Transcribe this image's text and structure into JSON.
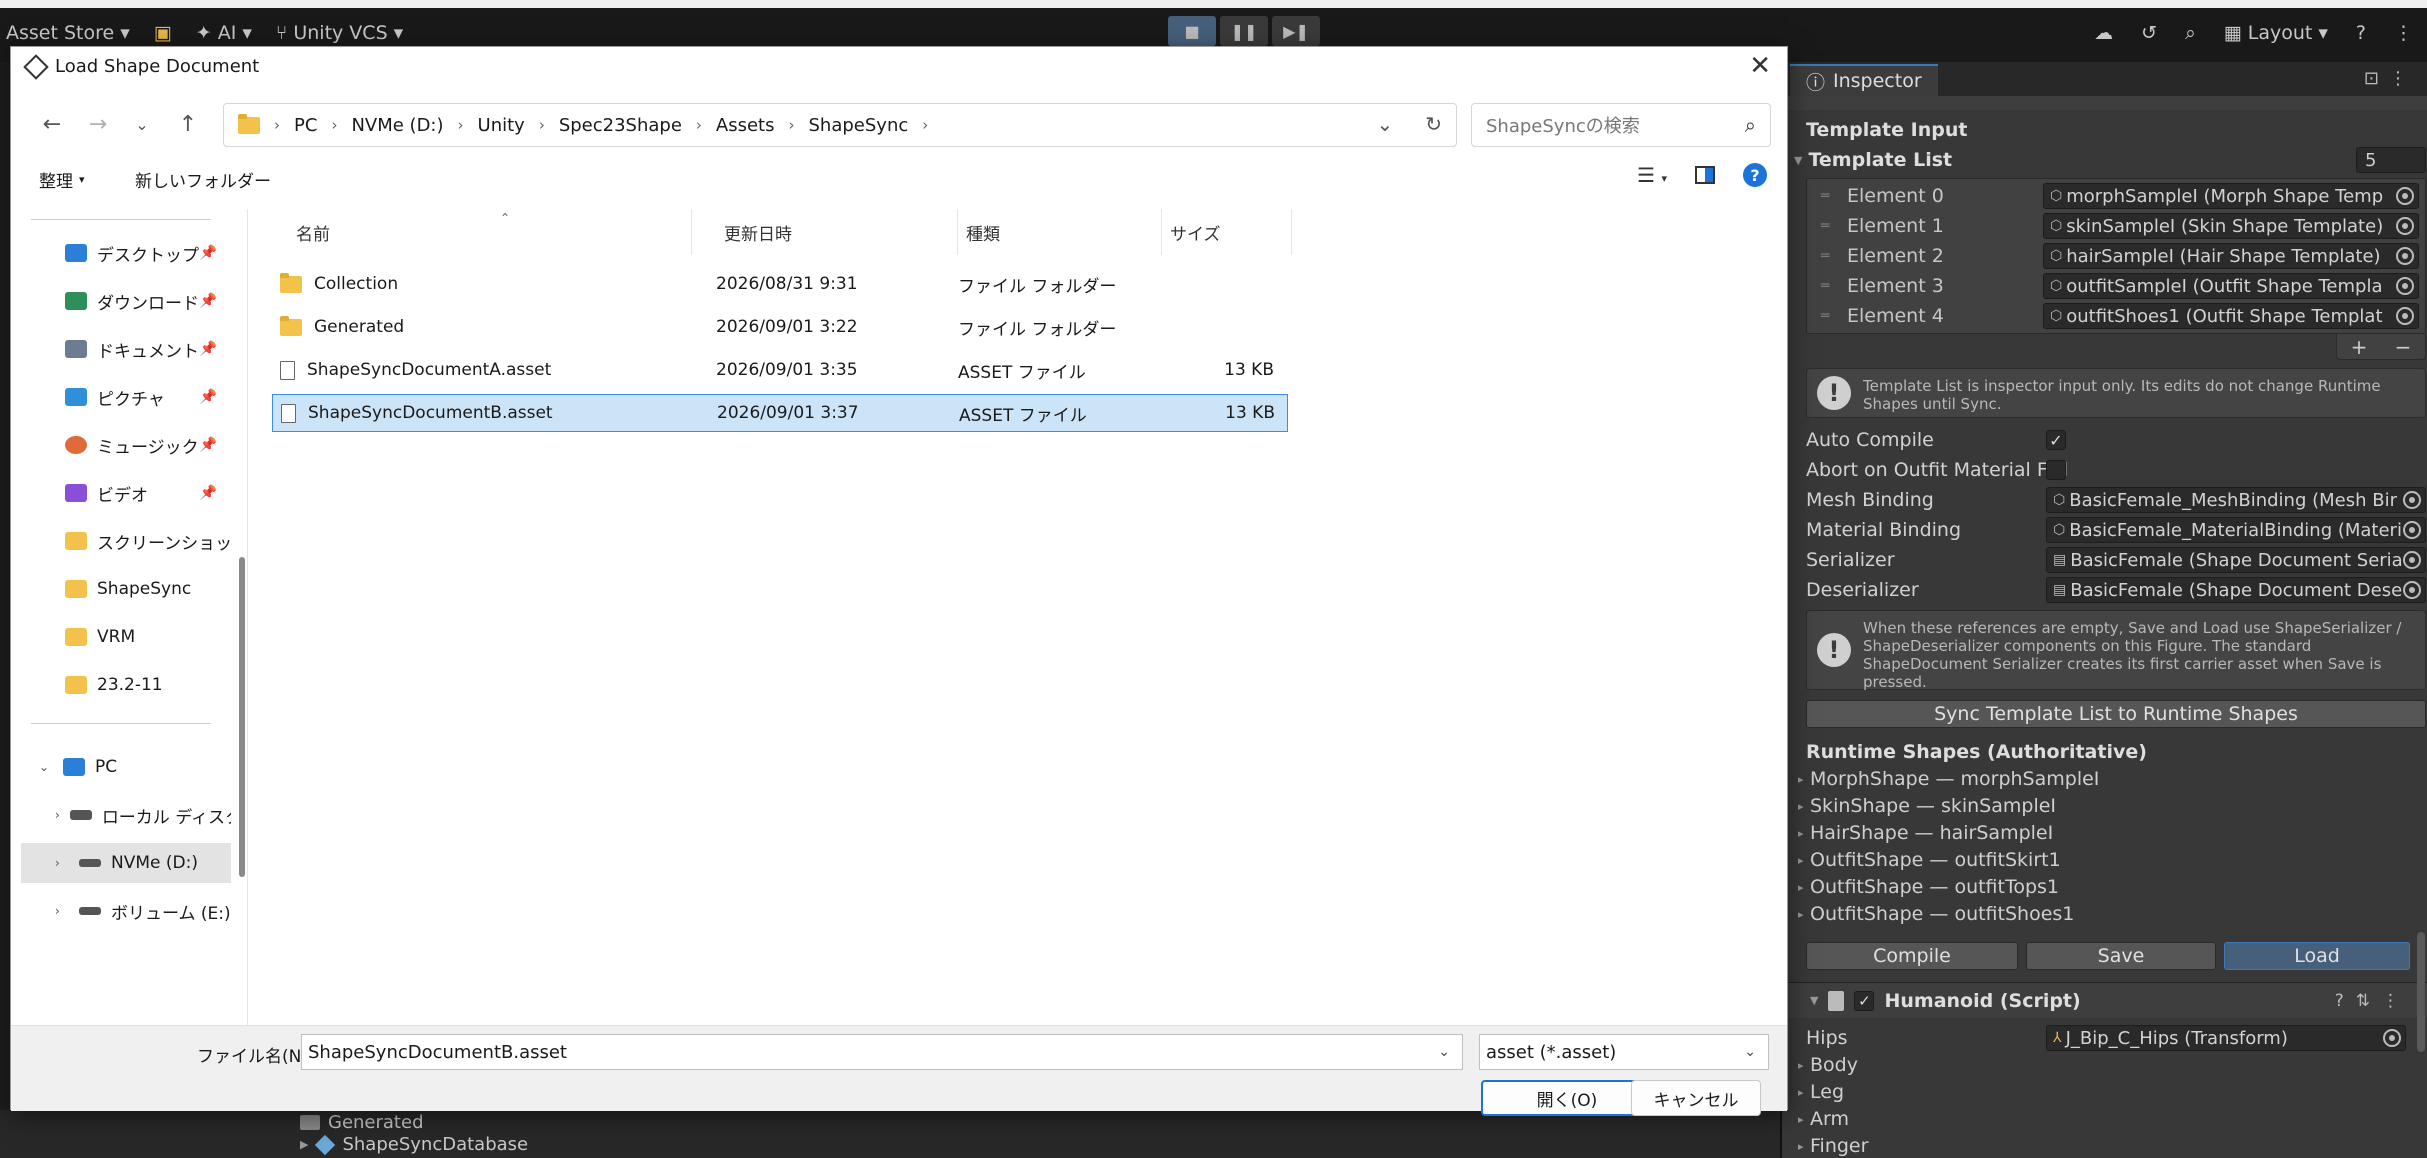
{
  "unity_toolbar": {
    "asset_store": "Asset Store",
    "ai": "AI",
    "vcs": "Unity VCS",
    "layout": "Layout"
  },
  "project_panel": {
    "items": [
      "Generated",
      "ShapeSyncDatabase"
    ]
  },
  "inspector": {
    "tab_label": "Inspector",
    "template_input_label": "Template Input",
    "template_list_label": "Template List",
    "template_list_size": "5",
    "elements": [
      {
        "label": "Element 0",
        "value": "morphSampleI (Morph Shape Temp"
      },
      {
        "label": "Element 1",
        "value": "skinSampleI (Skin Shape Template)"
      },
      {
        "label": "Element 2",
        "value": "hairSampleI (Hair Shape Template)"
      },
      {
        "label": "Element 3",
        "value": "outfitSampleI (Outfit Shape Templa"
      },
      {
        "label": "Element 4",
        "value": "outfitShoes1 (Outfit Shape Templat"
      }
    ],
    "help_template": "Template List is inspector input only. Its edits do not change Runtime Shapes until Sync.",
    "auto_compile_label": "Auto Compile",
    "abort_label": "Abort on Outfit Material Fail",
    "mesh_binding_label": "Mesh Binding",
    "mesh_binding_value": "BasicFemale_MeshBinding (Mesh Bir",
    "material_binding_label": "Material Binding",
    "material_binding_value": "BasicFemale_MaterialBinding (Materi",
    "serializer_label": "Serializer",
    "serializer_value": "BasicFemale (Shape Document Seria",
    "deserializer_label": "Deserializer",
    "deserializer_value": "BasicFemale (Shape Document Dese",
    "help_refs": "When these references are empty, Save and Load use ShapeSerializer / ShapeDeserializer components on this Figure. The standard ShapeDocument Serializer creates its first carrier asset when Save is pressed.",
    "sync_button": "Sync Template List to Runtime Shapes",
    "runtime_shapes_label": "Runtime Shapes (Authoritative)",
    "runtime_shapes": [
      "MorphShape — morphSampleI",
      "SkinShape — skinSampleI",
      "HairShape — hairSampleI",
      "OutfitShape — outfitSkirt1",
      "OutfitShape — outfitTops1",
      "OutfitShape — outfitShoes1"
    ],
    "compile_button": "Compile",
    "save_button": "Save",
    "load_button": "Load",
    "humanoid_header": "Humanoid (Script)",
    "hips_label": "Hips",
    "hips_value": "J_Bip_C_Hips (Transform)",
    "humanoid_foldouts": [
      "Body",
      "Leg",
      "Arm",
      "Finger"
    ]
  },
  "dialog": {
    "title": "Load Shape Document",
    "breadcrumbs": [
      "PC",
      "NVMe (D:)",
      "Unity",
      "Spec23Shape",
      "Assets",
      "ShapeSync"
    ],
    "search_placeholder": "ShapeSyncの検索",
    "organize_label": "整理",
    "new_folder_label": "新しいフォルダー",
    "nav_items": [
      {
        "label": "デスクトップ",
        "pinned": true,
        "color": "#2b7fd9"
      },
      {
        "label": "ダウンロード",
        "pinned": true,
        "color": "#2f8f5a"
      },
      {
        "label": "ドキュメント",
        "pinned": true,
        "color": "#6b7c93"
      },
      {
        "label": "ピクチャ",
        "pinned": true,
        "color": "#2f8fd9"
      },
      {
        "label": "ミュージック",
        "pinned": true,
        "color": "#e06a3a"
      },
      {
        "label": "ビデオ",
        "pinned": true,
        "color": "#8a4fd9"
      },
      {
        "label": "スクリーンショット",
        "pinned": false,
        "color": "#f2c24a"
      },
      {
        "label": "ShapeSync",
        "pinned": false,
        "color": "#f2c24a"
      },
      {
        "label": "VRM",
        "pinned": false,
        "color": "#f2c24a"
      },
      {
        "label": "23.2-11",
        "pinned": false,
        "color": "#f2c24a"
      }
    ],
    "tree_items": [
      {
        "label": "PC",
        "expanded": true
      },
      {
        "label": "ローカル ディスク",
        "expanded": false
      },
      {
        "label": "NVMe (D:)",
        "expanded": false
      },
      {
        "label": "ボリューム (E:)",
        "expanded": false
      }
    ],
    "columns": {
      "name": "名前",
      "date": "更新日時",
      "type": "種類",
      "size": "サイズ"
    },
    "files": [
      {
        "name": "Collection",
        "date": "2026/08/31 9:31",
        "type": "ファイル フォルダー",
        "size": "",
        "kind": "folder"
      },
      {
        "name": "Generated",
        "date": "2026/09/01 3:22",
        "type": "ファイル フォルダー",
        "size": "",
        "kind": "folder"
      },
      {
        "name": "ShapeSyncDocumentA.asset",
        "date": "2026/09/01 3:35",
        "type": "ASSET ファイル",
        "size": "13 KB",
        "kind": "file"
      },
      {
        "name": "ShapeSyncDocumentB.asset",
        "date": "2026/09/01 3:37",
        "type": "ASSET ファイル",
        "size": "13 KB",
        "kind": "file",
        "selected": true
      }
    ],
    "filename_label": "ファイル名(N):",
    "filename_value": "ShapeSyncDocumentB.asset",
    "filter_value": "asset (*.asset)",
    "open_button": "開く(O)",
    "cancel_button": "キャンセル"
  }
}
